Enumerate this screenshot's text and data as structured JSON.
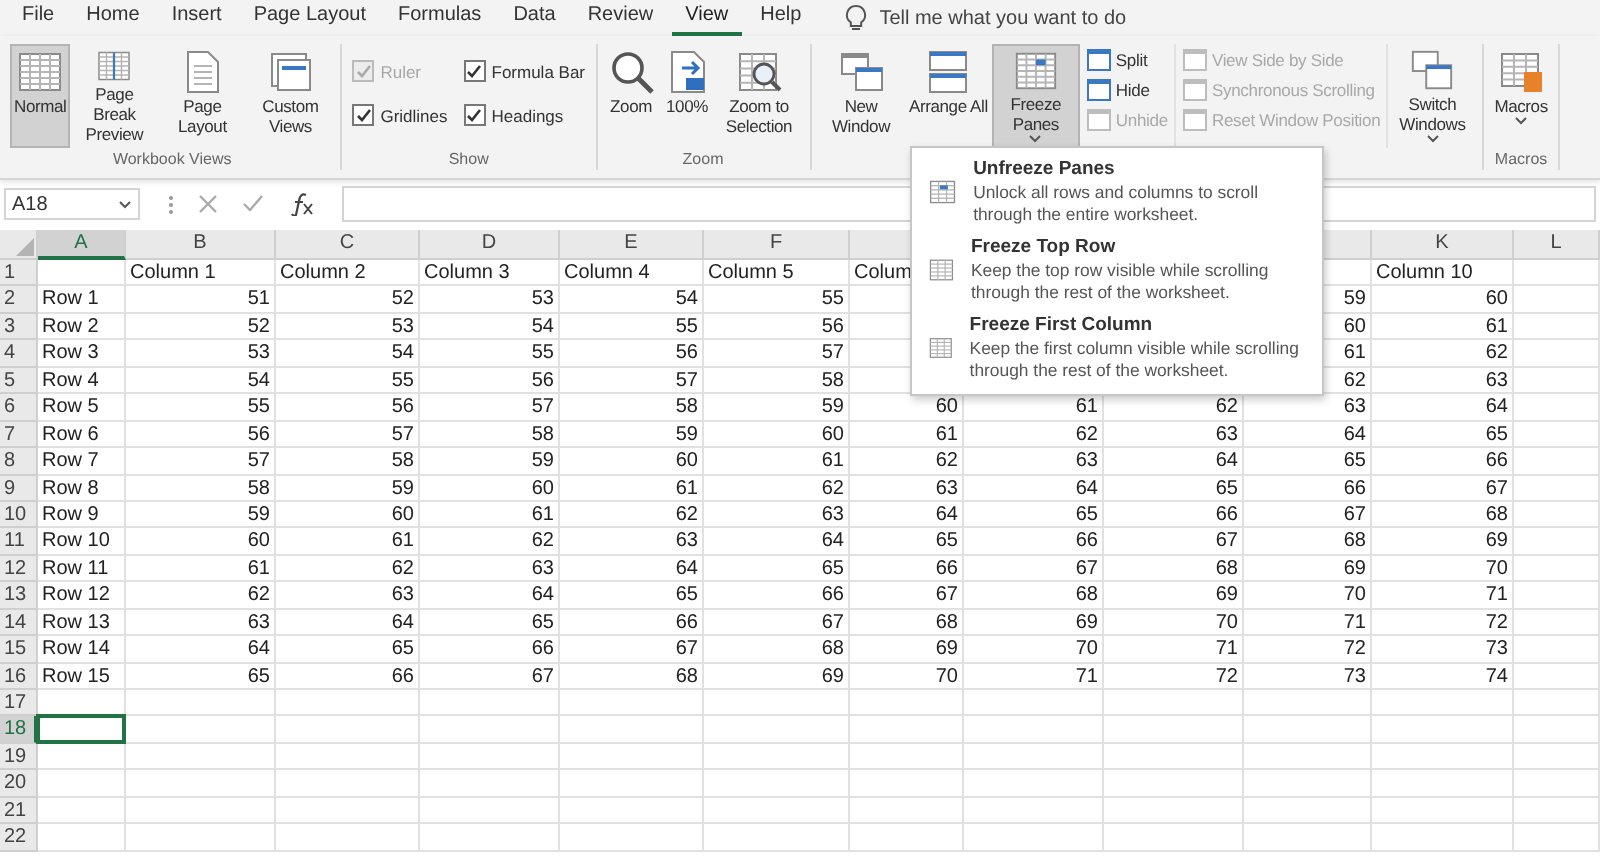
{
  "tabs": [
    {
      "label": "File",
      "selected": false
    },
    {
      "label": "Home",
      "selected": false
    },
    {
      "label": "Insert",
      "selected": false
    },
    {
      "label": "Page Layout",
      "selected": false
    },
    {
      "label": "Formulas",
      "selected": false
    },
    {
      "label": "Data",
      "selected": false
    },
    {
      "label": "Review",
      "selected": false
    },
    {
      "label": "View",
      "selected": true
    },
    {
      "label": "Help",
      "selected": false
    }
  ],
  "tell_me": {
    "placeholder": "Tell me what you want to do"
  },
  "ribbon": {
    "groups": [
      {
        "label": "Workbook Views",
        "items": [
          {
            "kind": "large",
            "label": "Normal",
            "selected": true,
            "dropdown": false
          },
          {
            "kind": "large",
            "label": "Page Break Preview",
            "selected": false,
            "dropdown": false
          },
          {
            "kind": "large",
            "label": "Page Layout",
            "selected": false,
            "dropdown": false
          },
          {
            "kind": "large",
            "label": "Custom Views",
            "selected": false,
            "dropdown": false
          }
        ]
      },
      {
        "label": "Show",
        "items": [
          {
            "kind": "checks",
            "items": [
              {
                "label": "Ruler",
                "checked": true,
                "disabled": true
              },
              {
                "label": "Formula Bar",
                "checked": true,
                "disabled": false
              },
              {
                "label": "Gridlines",
                "checked": true,
                "disabled": false
              },
              {
                "label": "Headings",
                "checked": true,
                "disabled": false
              }
            ]
          }
        ]
      },
      {
        "label": "Zoom",
        "items": [
          {
            "kind": "large",
            "label": "Zoom",
            "selected": false,
            "dropdown": false
          },
          {
            "kind": "large",
            "label": "100%",
            "selected": false,
            "dropdown": false
          },
          {
            "kind": "large",
            "label": "Zoom to Selection",
            "selected": false,
            "dropdown": false
          }
        ]
      },
      {
        "items": [
          {
            "kind": "large",
            "label": "New Window",
            "selected": false,
            "dropdown": false
          },
          {
            "kind": "large",
            "label": "Arrange All",
            "selected": false,
            "dropdown": false
          },
          {
            "kind": "large",
            "label": "Freeze Panes",
            "selected": true,
            "dropdown": true
          },
          {
            "kind": "stack",
            "items": [
              {
                "label": "Split",
                "disabled": false
              },
              {
                "label": "Hide",
                "disabled": false
              },
              {
                "label": "Unhide",
                "disabled": true
              }
            ]
          },
          {
            "kind": "stack",
            "items": [
              {
                "label": "View Side by Side",
                "disabled": true
              },
              {
                "label": "Synchronous Scrolling",
                "disabled": true
              },
              {
                "label": "Reset Window Position",
                "disabled": true
              }
            ]
          },
          {
            "kind": "large",
            "label": "Switch Windows",
            "selected": false,
            "dropdown": true
          }
        ]
      },
      {
        "label": "Macros",
        "items": [
          {
            "kind": "large",
            "label": "Macros",
            "selected": false,
            "dropdown": true
          }
        ]
      }
    ]
  },
  "formula_bar": {
    "name_box": "A18"
  },
  "freeze_menu": {
    "items": [
      {
        "title": "Unfreeze Panes",
        "description": "Unlock all rows and columns to scroll through the entire worksheet."
      },
      {
        "title": "Freeze Top Row",
        "description": "Keep the top row visible while scrolling through the rest of the worksheet."
      },
      {
        "title": "Freeze First Column",
        "description": "Keep the first column visible while scrolling through the rest of the worksheet."
      }
    ]
  },
  "sheet": {
    "columns": [
      {
        "label": "A",
        "selected": true
      },
      {
        "label": "B",
        "selected": false
      },
      {
        "label": "C",
        "selected": false
      },
      {
        "label": "D",
        "selected": false
      },
      {
        "label": "E",
        "selected": false
      },
      {
        "label": "F",
        "selected": false
      },
      {
        "selected": false
      },
      {},
      {},
      {
        "selected": false
      },
      {
        "label": "K",
        "selected": false
      },
      {
        "label": "L",
        "selected": false
      }
    ],
    "rows": [
      {
        "number": "1",
        "selected": false,
        "kind": "text",
        "cells": [
          null,
          "Column 1",
          "Column 2",
          "Column 3",
          "Column 4",
          "Column 5",
          "Colum",
          null,
          null,
          null,
          "Column 10"
        ]
      },
      {
        "number": "2",
        "selected": false,
        "kind": "numbers",
        "cells": [
          "Row 1",
          "51",
          "52",
          "53",
          "54",
          "55",
          null,
          null,
          null,
          "59",
          "60"
        ]
      },
      {
        "number": "3",
        "selected": false,
        "kind": "numbers",
        "cells": [
          "Row 2",
          "52",
          "53",
          "54",
          "55",
          "56",
          null,
          null,
          null,
          "60",
          "61"
        ]
      },
      {
        "number": "4",
        "selected": false,
        "kind": "numbers",
        "cells": [
          "Row 3",
          "53",
          "54",
          "55",
          "56",
          "57",
          null,
          null,
          null,
          "61",
          "62"
        ]
      },
      {
        "number": "5",
        "selected": false,
        "kind": "numbers",
        "cells": [
          "Row 4",
          "54",
          "55",
          "56",
          "57",
          "58",
          null,
          null,
          null,
          "62",
          "63"
        ]
      },
      {
        "number": "6",
        "selected": false,
        "kind": "numbers",
        "cells": [
          "Row 5",
          "55",
          "56",
          "57",
          "58",
          "59",
          "60",
          "61",
          "62",
          "63",
          "64"
        ]
      },
      {
        "number": "7",
        "selected": false,
        "kind": "numbers",
        "cells": [
          "Row 6",
          "56",
          "57",
          "58",
          "59",
          "60",
          "61",
          "62",
          "63",
          "64",
          "65"
        ]
      },
      {
        "number": "8",
        "selected": false,
        "kind": "numbers",
        "cells": [
          "Row 7",
          "57",
          "58",
          "59",
          "60",
          "61",
          "62",
          "63",
          "64",
          "65",
          "66"
        ]
      },
      {
        "number": "9",
        "selected": false,
        "kind": "numbers",
        "cells": [
          "Row 8",
          "58",
          "59",
          "60",
          "61",
          "62",
          "63",
          "64",
          "65",
          "66",
          "67"
        ]
      },
      {
        "number": "10",
        "selected": false,
        "kind": "numbers",
        "cells": [
          "Row 9",
          "59",
          "60",
          "61",
          "62",
          "63",
          "64",
          "65",
          "66",
          "67",
          "68"
        ]
      },
      {
        "number": "11",
        "selected": false,
        "kind": "numbers",
        "cells": [
          "Row 10",
          "60",
          "61",
          "62",
          "63",
          "64",
          "65",
          "66",
          "67",
          "68",
          "69"
        ]
      },
      {
        "number": "12",
        "selected": false,
        "kind": "numbers",
        "cells": [
          "Row 11",
          "61",
          "62",
          "63",
          "64",
          "65",
          "66",
          "67",
          "68",
          "69",
          "70"
        ]
      },
      {
        "number": "13",
        "selected": false,
        "kind": "numbers",
        "cells": [
          "Row 12",
          "62",
          "63",
          "64",
          "65",
          "66",
          "67",
          "68",
          "69",
          "70",
          "71"
        ]
      },
      {
        "number": "14",
        "selected": false,
        "kind": "numbers",
        "cells": [
          "Row 13",
          "63",
          "64",
          "65",
          "66",
          "67",
          "68",
          "69",
          "70",
          "71",
          "72"
        ]
      },
      {
        "number": "15",
        "selected": false,
        "kind": "numbers",
        "cells": [
          "Row 14",
          "64",
          "65",
          "66",
          "67",
          "68",
          "69",
          "70",
          "71",
          "72",
          "73"
        ]
      },
      {
        "number": "16",
        "selected": false,
        "kind": "numbers",
        "cells": [
          "Row 15",
          "65",
          "66",
          "67",
          "68",
          "69",
          "70",
          "71",
          "72",
          "73",
          "74"
        ]
      },
      {
        "number": "17",
        "selected": false,
        "kind": "blank"
      },
      {
        "number": "18",
        "selected": true,
        "kind": "blank"
      },
      {
        "number": "19",
        "selected": false,
        "kind": "blank"
      },
      {
        "number": "20",
        "selected": false,
        "kind": "blank"
      },
      {
        "number": "21",
        "selected": false,
        "kind": "blank"
      },
      {
        "number": "22",
        "selected": false,
        "kind": "blank"
      }
    ]
  }
}
